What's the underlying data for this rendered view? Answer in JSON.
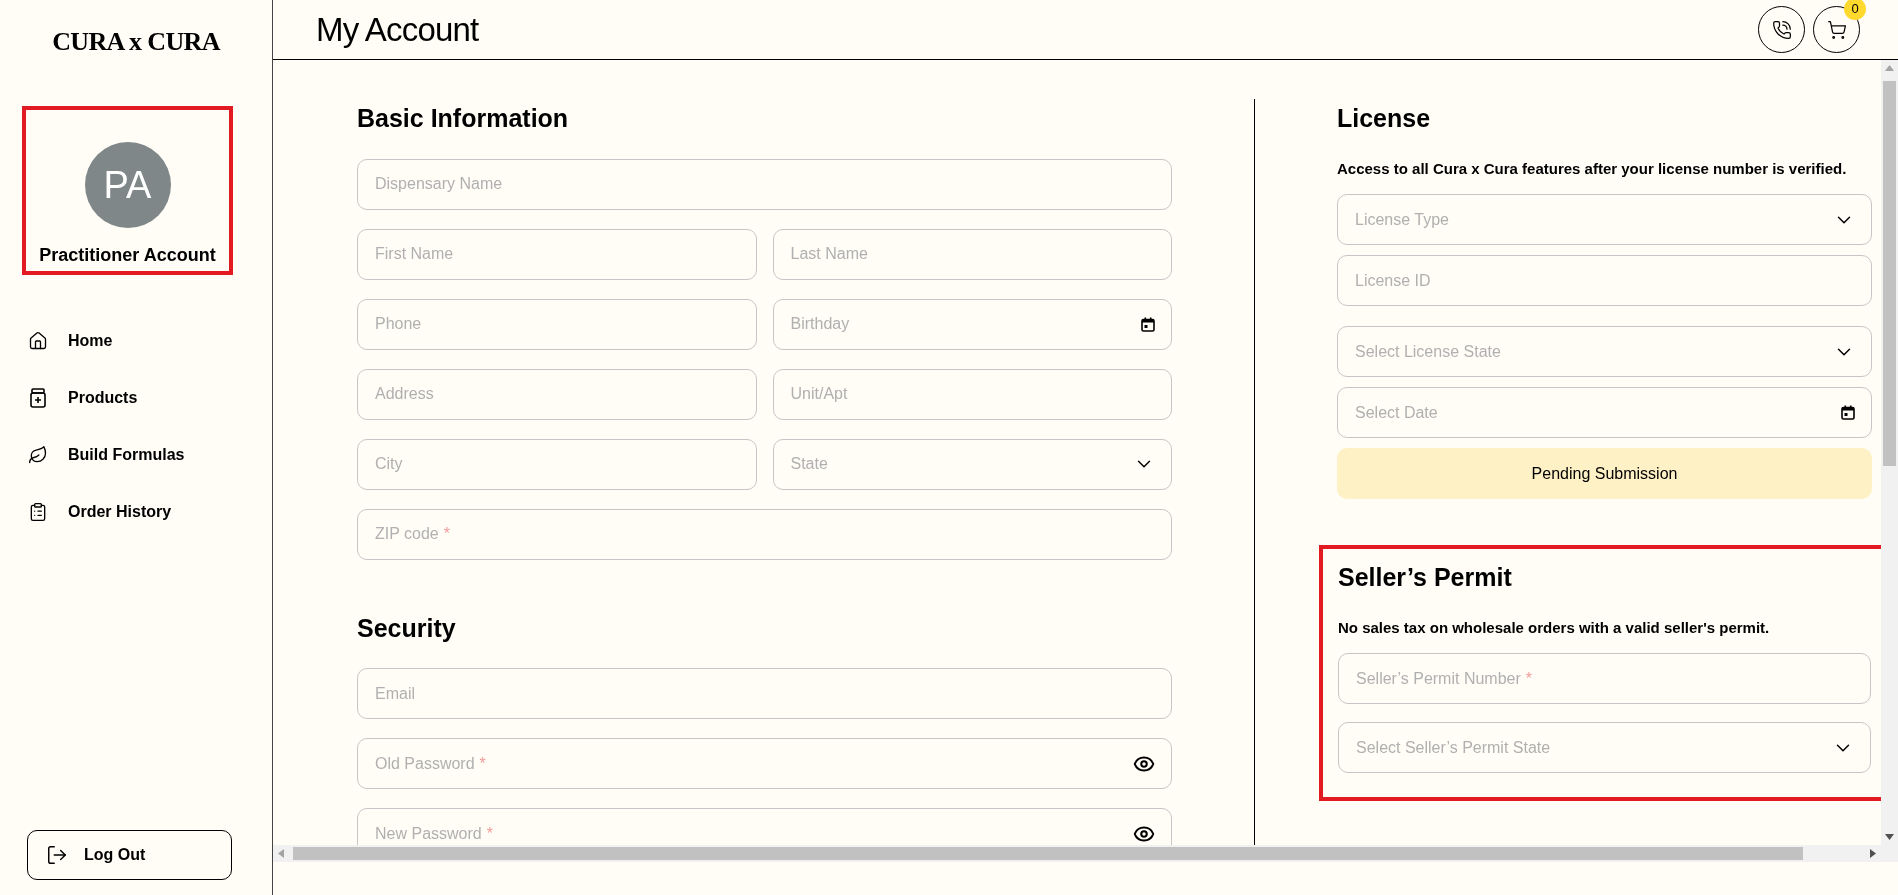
{
  "brand": "CURA x CURA",
  "profile": {
    "initials": "PA",
    "name": "Practitioner Account",
    "highlighted": true
  },
  "nav": [
    {
      "label": "Home",
      "kind": "home"
    },
    {
      "label": "Products",
      "kind": "products"
    },
    {
      "label": "Build Formulas",
      "kind": "formulas"
    },
    {
      "label": "Order History",
      "kind": "orders"
    }
  ],
  "logout": {
    "label": "Log Out"
  },
  "header": {
    "title": "My Account",
    "cart_count": "0"
  },
  "basic": {
    "title": "Basic Information",
    "rows": [
      [
        {
          "kind": "text",
          "placeholder": "Dispensary Name"
        }
      ],
      [
        {
          "kind": "text",
          "placeholder": "First Name"
        },
        {
          "kind": "text",
          "placeholder": "Last Name"
        }
      ],
      [
        {
          "kind": "text",
          "placeholder": "Phone"
        },
        {
          "kind": "date",
          "placeholder": "Birthday"
        }
      ],
      [
        {
          "kind": "text",
          "placeholder": "Address"
        },
        {
          "kind": "text",
          "placeholder": "Unit/Apt"
        }
      ],
      [
        {
          "kind": "text",
          "placeholder": "City"
        },
        {
          "kind": "select",
          "placeholder": "State"
        }
      ],
      [
        {
          "kind": "text",
          "placeholder": "ZIP code",
          "required_mark": "*"
        }
      ]
    ]
  },
  "security": {
    "title": "Security",
    "rows": [
      [
        {
          "kind": "text",
          "placeholder": "Email"
        }
      ],
      [
        {
          "kind": "password",
          "placeholder": "Old Password",
          "required_mark": "*"
        }
      ],
      [
        {
          "kind": "password",
          "placeholder": "New Password",
          "required_mark": "*"
        }
      ]
    ]
  },
  "license": {
    "title": "License",
    "description": "Access to all Cura x Cura features after your license number is verified.",
    "fields": [
      {
        "kind": "select",
        "placeholder": "License Type"
      },
      {
        "kind": "text",
        "placeholder": "License ID"
      },
      {
        "kind": "select",
        "placeholder": "Select License State"
      },
      {
        "kind": "date",
        "placeholder": "Select Date"
      }
    ],
    "status": "Pending Submission"
  },
  "sellers_permit": {
    "title": "Seller’s Permit",
    "description": "No sales tax on wholesale orders with a valid seller's permit.",
    "highlighted": true,
    "fields": [
      {
        "kind": "text",
        "placeholder": "Seller’s Permit Number",
        "required_mark": "*"
      },
      {
        "kind": "select",
        "placeholder": "Select Seller’s Permit State"
      }
    ]
  }
}
